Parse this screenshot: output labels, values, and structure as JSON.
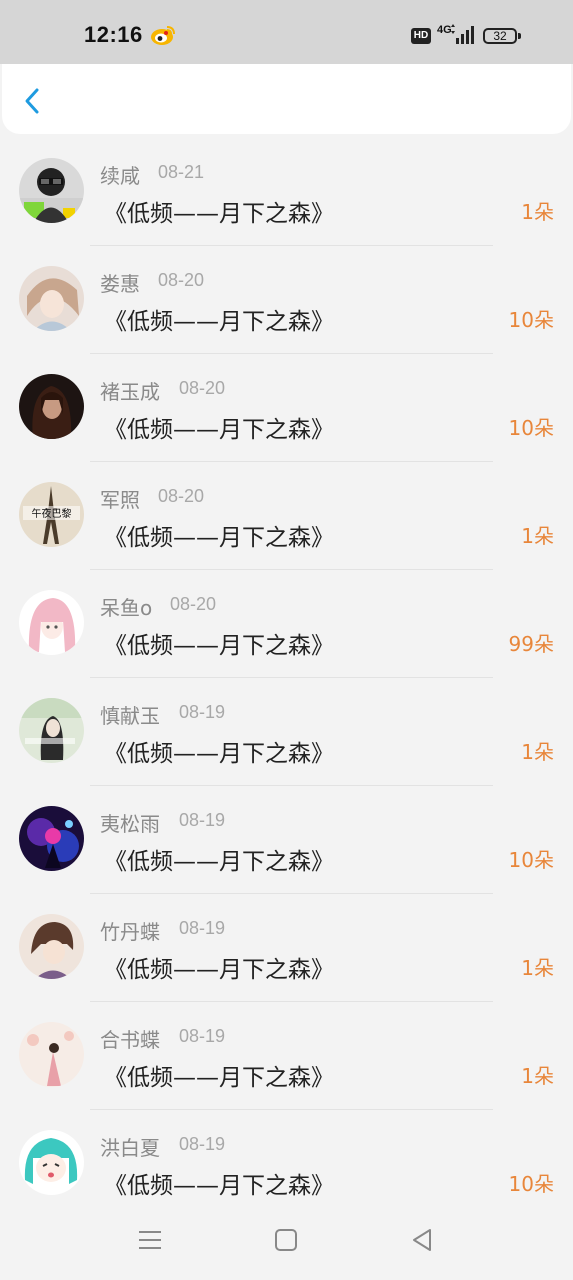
{
  "status_bar": {
    "time": "12:16",
    "hd": "HD",
    "network": "4G",
    "battery": "32"
  },
  "nav": {
    "back_icon": "chevron-left-icon"
  },
  "items": [
    {
      "name": "续咸",
      "date": "08-21",
      "title": "《低频——月下之森》",
      "count": "1朵"
    },
    {
      "name": "娄惠",
      "date": "08-20",
      "title": "《低频——月下之森》",
      "count": "10朵"
    },
    {
      "name": "褚玉成",
      "date": "08-20",
      "title": "《低频——月下之森》",
      "count": "10朵"
    },
    {
      "name": "军照",
      "date": "08-20",
      "title": "《低频——月下之森》",
      "count": "1朵",
      "avatar_text": "午夜巴黎"
    },
    {
      "name": "呆鱼o",
      "date": "08-20",
      "title": "《低频——月下之森》",
      "count": "99朵"
    },
    {
      "name": "慎献玉",
      "date": "08-19",
      "title": "《低频——月下之森》",
      "count": "1朵"
    },
    {
      "name": "夷松雨",
      "date": "08-19",
      "title": "《低频——月下之森》",
      "count": "10朵"
    },
    {
      "name": "竹丹蝶",
      "date": "08-19",
      "title": "《低频——月下之森》",
      "count": "1朵"
    },
    {
      "name": "合书蝶",
      "date": "08-19",
      "title": "《低频——月下之森》",
      "count": "1朵"
    },
    {
      "name": "洪白夏",
      "date": "08-19",
      "title": "《低频——月下之森》",
      "count": "10朵"
    }
  ],
  "colors": {
    "accent": "#1e9be0",
    "count": "#e8863a"
  }
}
